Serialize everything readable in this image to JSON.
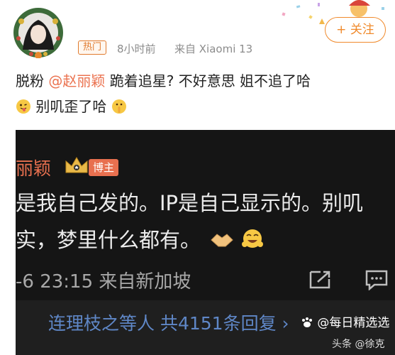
{
  "header": {
    "badge": "热门",
    "time": "8小时前",
    "source": "来自 Xiaomi 13",
    "follow_label": "+ 关注"
  },
  "post": {
    "prefix": "脱粉 ",
    "mention": "@赵丽颖",
    "text1": " 跪着追星? 不好意思 姐不追了哈",
    "text2": " 别叽歪了哈"
  },
  "screenshot": {
    "name": "丽颖",
    "badge": "博主",
    "line1": "是我自己发的。IP是自己显示的。别叽",
    "line2": "实，梦里什么都有。",
    "meta": "-6 23:15  来自新加坡",
    "reply": "连理枝之等人  共4151条回复  ›"
  },
  "watermark": {
    "main": "@每日精选选",
    "sub": "头条 @徐克"
  }
}
